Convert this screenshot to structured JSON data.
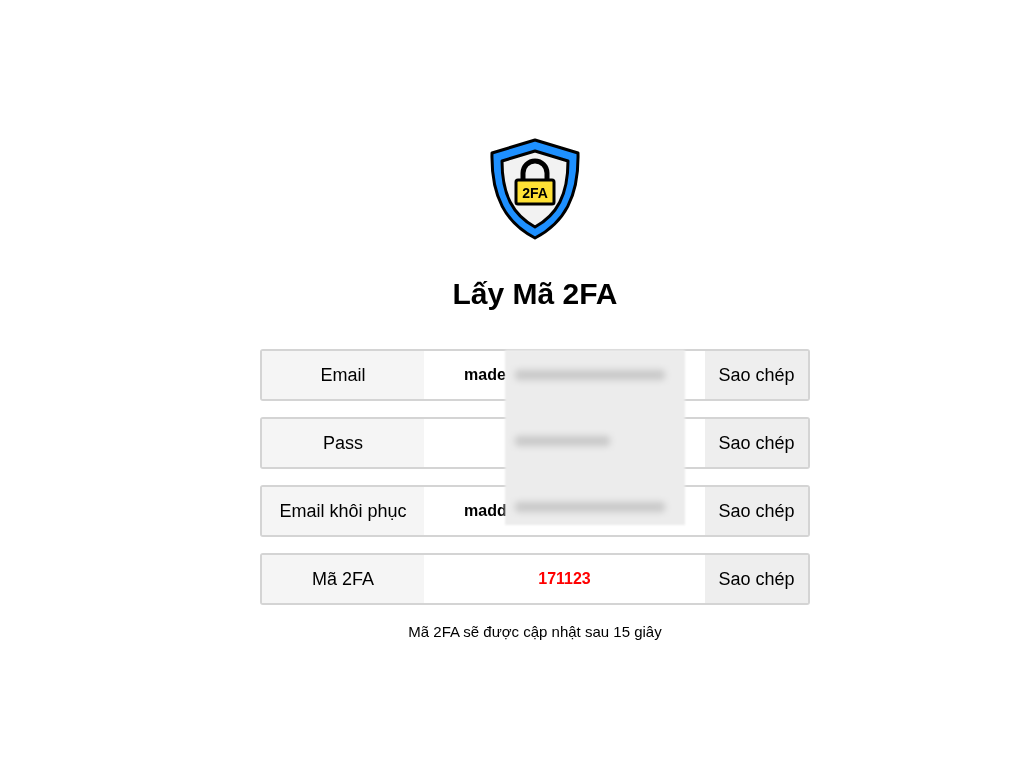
{
  "logo": {
    "text": "2FA"
  },
  "title": "Lấy Mã 2FA",
  "rows": [
    {
      "label": "Email",
      "kind": "redacted",
      "value": "made",
      "button": "Sao chép"
    },
    {
      "label": "Pass",
      "kind": "hidden",
      "button": "Sao chép"
    },
    {
      "label": "Email khôi phục",
      "kind": "redacted",
      "value": "madd",
      "button": "Sao chép"
    },
    {
      "label": "Mã 2FA",
      "kind": "code",
      "value": "171123",
      "button": "Sao chép"
    }
  ],
  "note": "Mã 2FA sẽ được cập nhật sau 15 giây"
}
